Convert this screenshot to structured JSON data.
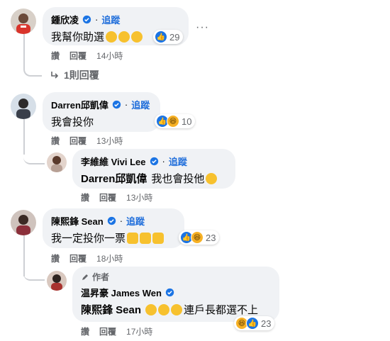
{
  "comments": [
    {
      "name": "鍾欣凌",
      "follow": "追蹤",
      "text": "我幫你助選",
      "reaction_count": "29",
      "actions": {
        "like": "讚",
        "reply": "回覆",
        "time": "14小時"
      },
      "replies_link": "1則回覆"
    },
    {
      "name": "Darren邱凱偉",
      "follow": "追蹤",
      "text": "我會投你",
      "reaction_count": "10",
      "actions": {
        "like": "讚",
        "reply": "回覆",
        "time": "13小時"
      }
    },
    {
      "name": "李維維 Vivi Lee",
      "follow": "追蹤",
      "tag": "Darren邱凱偉",
      "text": "我也會投他",
      "actions": {
        "like": "讚",
        "reply": "回覆",
        "time": "13小時"
      }
    },
    {
      "name": "陳熙鋒 Sean",
      "follow": "追蹤",
      "text": "我一定投你一票",
      "reaction_count": "23",
      "actions": {
        "like": "讚",
        "reply": "回覆",
        "time": "18小時"
      }
    },
    {
      "author_badge": "作者",
      "name": "温昇豪 James Wen",
      "tag": "陳熙鋒 Sean",
      "text": "連戶長都選不上",
      "reaction_count": "23",
      "actions": {
        "like": "讚",
        "reply": "回覆",
        "time": "17小時"
      }
    }
  ],
  "more_menu": "···",
  "colors": {
    "link": "#216fdb",
    "bubble": "#f0f2f5",
    "meta": "#65676b",
    "like": "#1b74e4",
    "haha": "#f7b125"
  }
}
